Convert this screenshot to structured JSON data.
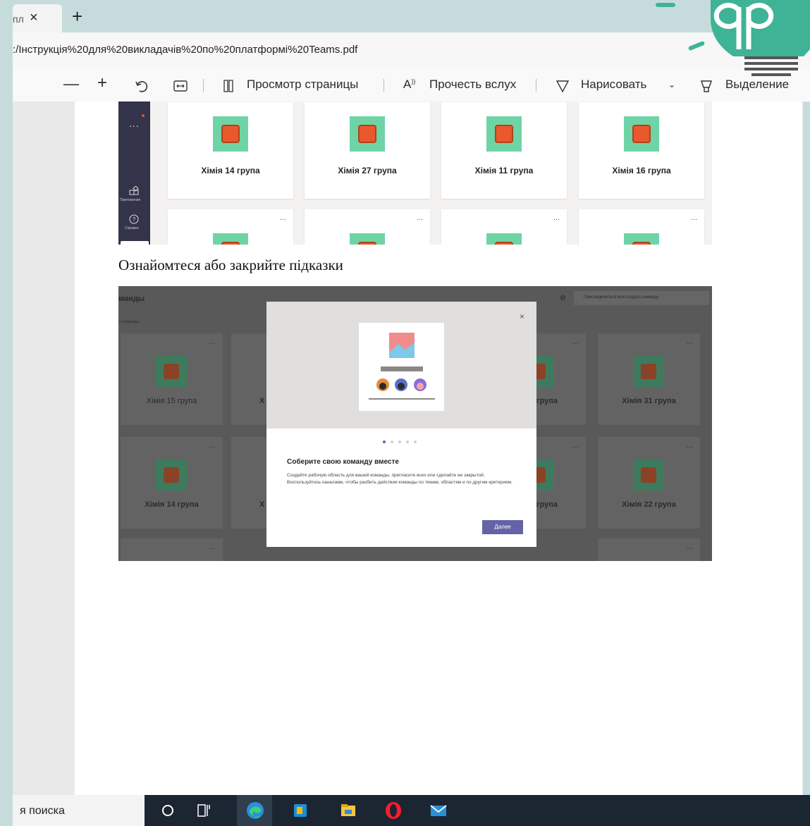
{
  "browser": {
    "tab_title": "пл",
    "tab_close": "×",
    "new_tab": "+",
    "url": ":/Інструкція%20для%20викладачів%20по%20платформі%20Teams.pdf"
  },
  "toolbar": {
    "zoom_out": "—",
    "zoom_in": "+",
    "page_view": "Просмотр страницы",
    "read_aloud": "Прочесть вслух",
    "draw": "Нарисовать",
    "highlight": "Выделение"
  },
  "shot1": {
    "rail_apps": "Приложения",
    "rail_help": "Справка",
    "teams": [
      "Хімія 14 група",
      "Хімія 27 група",
      "Хімія 11 група",
      "Хімія 16 група"
    ],
    "more": "..."
  },
  "caption": "Ознайомтеся або закрийте підказки",
  "shot2": {
    "header": "манды",
    "subheader": "и команды",
    "join_button": "Присоединиться или создать команду",
    "bg_cards": [
      "Хімія 15 група",
      "Хімія 31 група",
      "Хімія 14 група",
      "Хімія 22 група"
    ],
    "bg_fragments": [
      "Х",
      "група"
    ],
    "modal": {
      "title": "Соберите свою команду вместе",
      "body": "Создайте рабочую область для вашей команды, пригласите всех или сделайте ее закрытой. Воспользуйтесь каналами, чтобы разбить действия команды по темам, областям и по другим критериям.",
      "next": "Далее",
      "close": "×"
    }
  },
  "taskbar": {
    "search_text": "я поиска"
  },
  "colors": {
    "frame": "#c6dcdc",
    "teams_purple": "#6264a7",
    "teams_rail": "#33344a",
    "logo_green": "#3fb396"
  }
}
